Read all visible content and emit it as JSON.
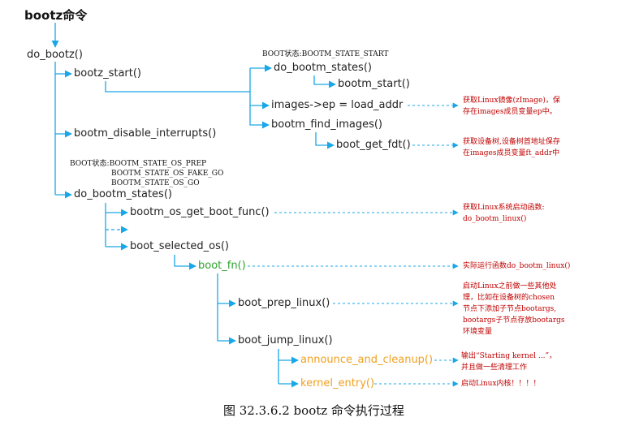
{
  "title": "bootz命令",
  "caption": "图 32.3.6.2 bootz 命令执行过程",
  "colors": {
    "connector": "#1aa7e8",
    "note_text": "#c00000",
    "node_text": "#222222",
    "green_text": "#2ea32e",
    "orange_text": "#f0a020"
  },
  "nodes": {
    "do_bootz": "do_bootz()",
    "bootz_start": "bootz_start()",
    "do_bootm_states_1": "do_bootm_states()",
    "bootm_start": "bootm_start()",
    "images_ep": "images->ep = load_addr",
    "bootm_find_images": "bootm_find_images()",
    "boot_get_fdt": "boot_get_fdt()",
    "bootm_disable_interrupts": "bootm_disable_interrupts()",
    "do_bootm_states_2": "do_bootm_states()",
    "bootm_os_get_boot_func": "bootm_os_get_boot_func()",
    "boot_selected_os": "boot_selected_os()",
    "boot_fn": "boot_fn()",
    "boot_prep_linux": "boot_prep_linux()",
    "boot_jump_linux": "boot_jump_linux()",
    "announce_and_cleanup": "announce_and_cleanup()",
    "kernel_entry": "kernel_entry()"
  },
  "states": {
    "start": "BOOT状态:BOOTM_STATE_START",
    "os_prep": "BOOT状态:BOOTM_STATE_OS_PREP",
    "os_fake_go": "BOOTM_STATE_OS_FAKE_GO",
    "os_go": "BOOTM_STATE_OS_GO"
  },
  "notes": {
    "images_ep": [
      "获取Linux镜像(zImage)，保",
      "存在images成员变量ep中。"
    ],
    "boot_get_fdt": [
      "获取设备树,设备树首地址保存",
      "在images成员变量ft_addr中"
    ],
    "boot_func": [
      "获取Linux系统启动函数:",
      "do_bootm_linux()"
    ],
    "boot_fn": [
      "实际运行函数do_bootm_linux()"
    ],
    "boot_prep_linux": [
      "启动Linux之前做一些其他处",
      "理，比如在设备树的chosen",
      "节点下添加子节点bootargs,",
      "bootargs子节点存放bootargs",
      "环境变量"
    ],
    "announce_and_cleanup": [
      "输出“Starting kernel ...”，",
      "并且做一些清理工作"
    ],
    "kernel_entry": [
      "启动Linux内核！！！！"
    ]
  }
}
